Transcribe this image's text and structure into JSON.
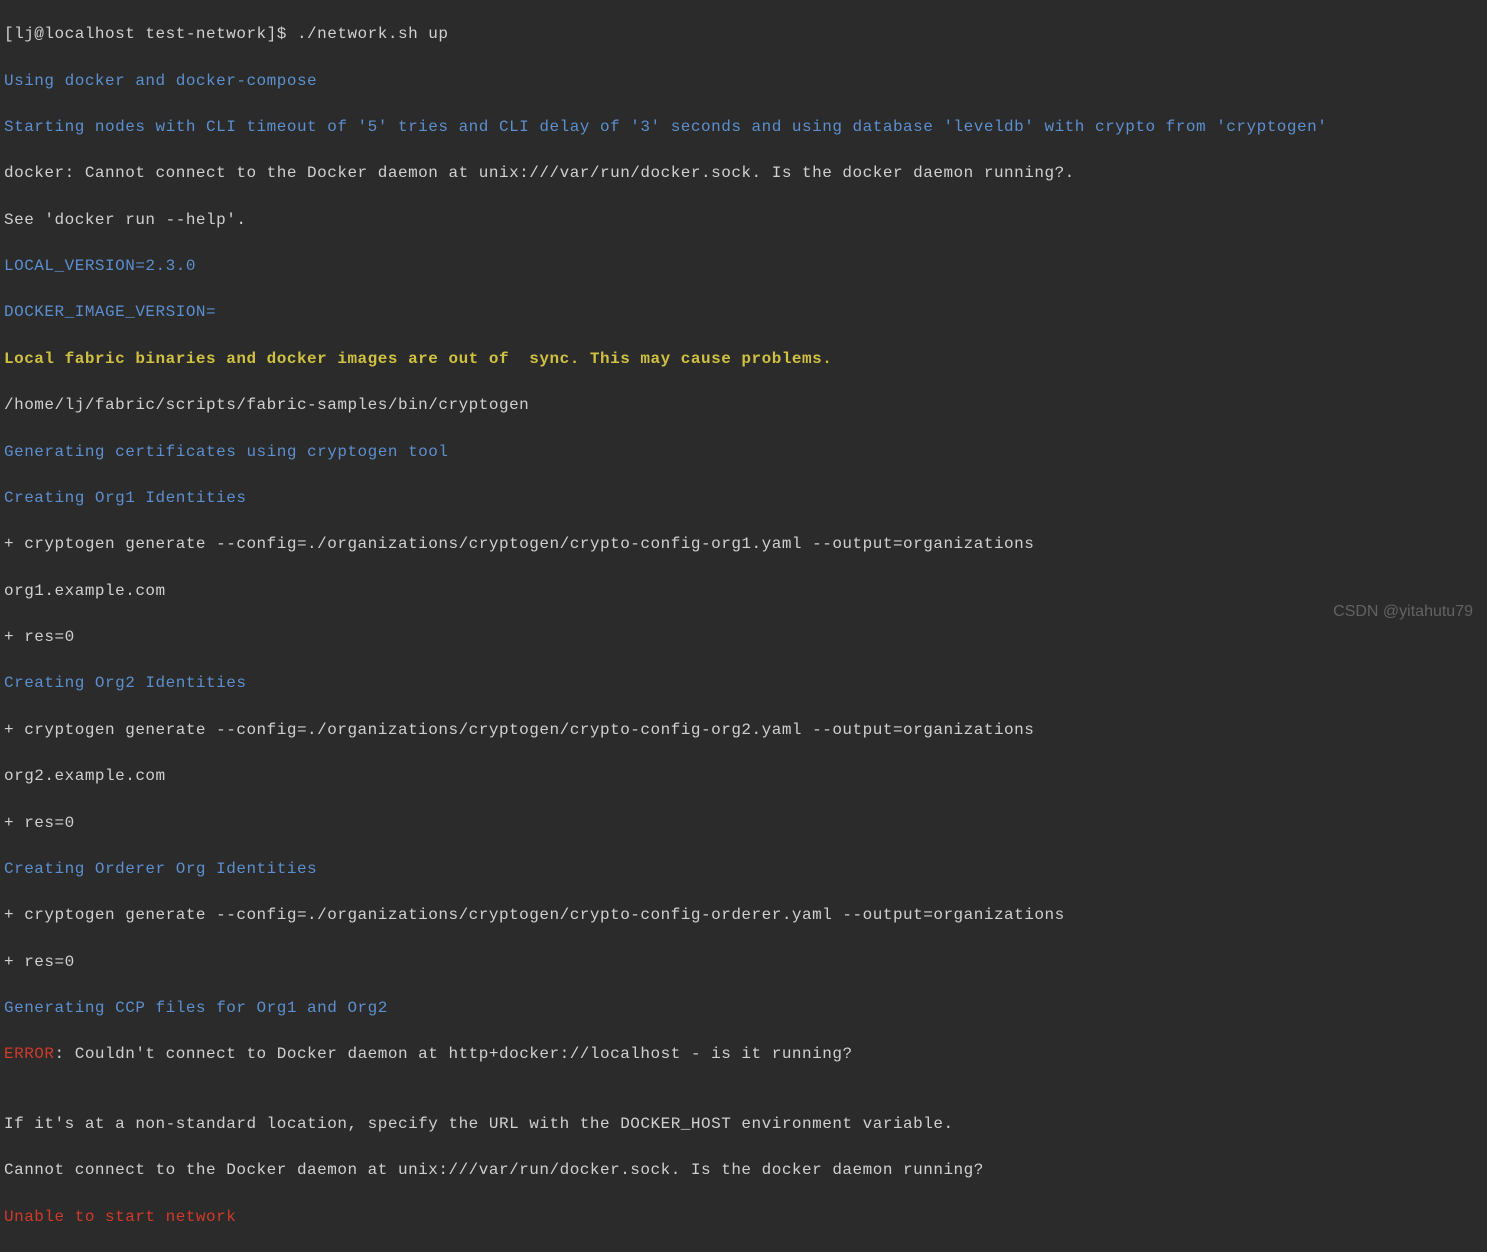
{
  "prompt_line": "[lj@localhost test-network]$ ./network.sh up",
  "lines": {
    "l1": "Using docker and docker-compose",
    "l2": "Starting nodes with CLI timeout of '5' tries and CLI delay of '3' seconds and using database 'leveldb' with crypto from 'cryptogen'",
    "l3": "docker: Cannot connect to the Docker daemon at unix:///var/run/docker.sock. Is the docker daemon running?.",
    "l4": "See 'docker run --help'.",
    "l5": "LOCAL_VERSION=2.3.0",
    "l6": "DOCKER_IMAGE_VERSION=",
    "l7": "Local fabric binaries and docker images are out of  sync. This may cause problems.",
    "l8": "/home/lj/fabric/scripts/fabric-samples/bin/cryptogen",
    "l9": "Generating certificates using cryptogen tool",
    "l10": "Creating Org1 Identities",
    "l11": "+ cryptogen generate --config=./organizations/cryptogen/crypto-config-org1.yaml --output=organizations",
    "l12": "org1.example.com",
    "l13": "+ res=0",
    "l14": "Creating Org2 Identities",
    "l15": "+ cryptogen generate --config=./organizations/cryptogen/crypto-config-org2.yaml --output=organizations",
    "l16": "org2.example.com",
    "l17": "+ res=0",
    "l18": "Creating Orderer Org Identities",
    "l19": "+ cryptogen generate --config=./organizations/cryptogen/crypto-config-orderer.yaml --output=organizations",
    "l20": "+ res=0",
    "l21": "Generating CCP files for Org1 and Org2",
    "l22a": "ERROR",
    "l22b": ": Couldn't connect to Docker daemon at http+docker://localhost - is it running?",
    "l23": "",
    "l24": "If it's at a non-standard location, specify the URL with the DOCKER_HOST environment variable.",
    "l25": "Cannot connect to the Docker daemon at unix:///var/run/docker.sock. Is the docker daemon running?",
    "l26": "Unable to start network"
  },
  "watermark": "CSDN @yitahutu79"
}
